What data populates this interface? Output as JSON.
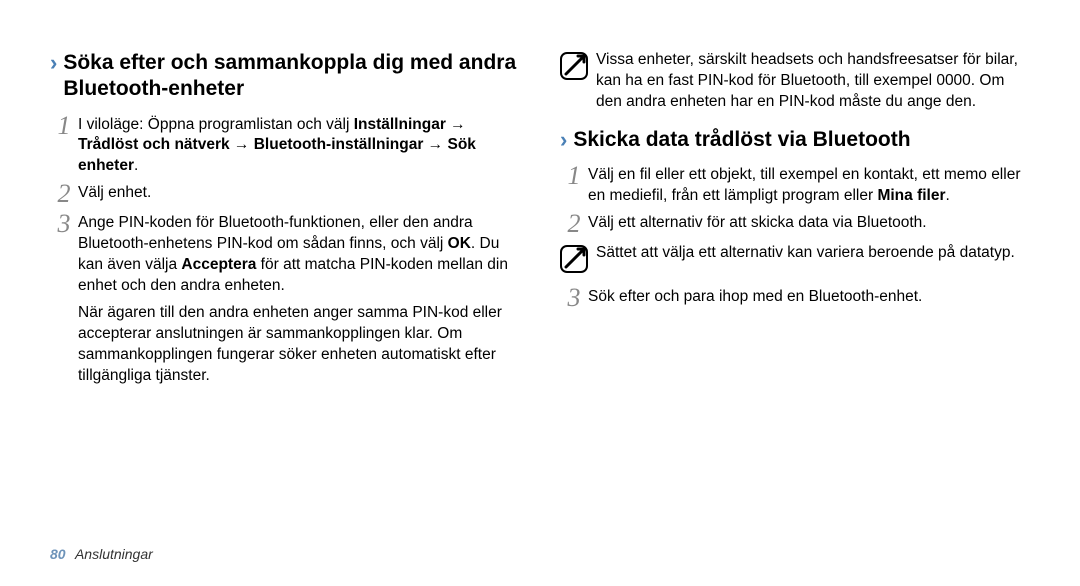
{
  "left": {
    "heading": "Söka efter och sammankoppla dig med andra Bluetooth-enheter",
    "step1_prefix": "I viloläge: Öppna programlistan och välj ",
    "step1_b1": "Inställningar",
    "step1_arrow1": " → ",
    "step1_b2": "Trådlöst och nätverk",
    "step1_arrow2": " → ",
    "step1_b3": "Bluetooth-inställningar",
    "step1_arrow3": " → ",
    "step1_b4": "Sök enheter",
    "step1_period": ".",
    "step2": "Välj enhet.",
    "step3_a": "Ange PIN-koden för Bluetooth-funktionen, eller den andra Bluetooth-enhetens PIN-kod om sådan finns, och välj ",
    "step3_ok": "OK",
    "step3_b": ". Du kan även välja ",
    "step3_acc": "Acceptera",
    "step3_c": " för att matcha PIN-koden mellan din enhet och den andra enheten.",
    "step3_para2": "När ägaren till den andra enheten anger samma PIN-kod eller accepterar anslutningen är sammankopplingen klar. Om sammankopplingen fungerar söker enheten automatiskt efter tillgängliga tjänster."
  },
  "right": {
    "note1": "Vissa enheter, särskilt headsets och handsfreesatser för bilar, kan ha en fast PIN-kod för Bluetooth, till exempel 0000. Om den andra enheten har en PIN-kod måste du ange den.",
    "heading": "Skicka data trådlöst via Bluetooth",
    "step1_a": "Välj en fil eller ett objekt, till exempel en kontakt, ett memo eller en mediefil, från ett lämpligt program eller ",
    "step1_b": "Mina filer",
    "step1_c": ".",
    "step2": "Välj ett alternativ för att skicka data via Bluetooth.",
    "note2": "Sättet att välja ett alternativ kan variera beroende på datatyp.",
    "step3": "Sök efter och para ihop med en Bluetooth-enhet."
  },
  "footer": {
    "page": "80",
    "section": "Anslutningar"
  },
  "nums": {
    "n1": "1",
    "n2": "2",
    "n3": "3"
  }
}
